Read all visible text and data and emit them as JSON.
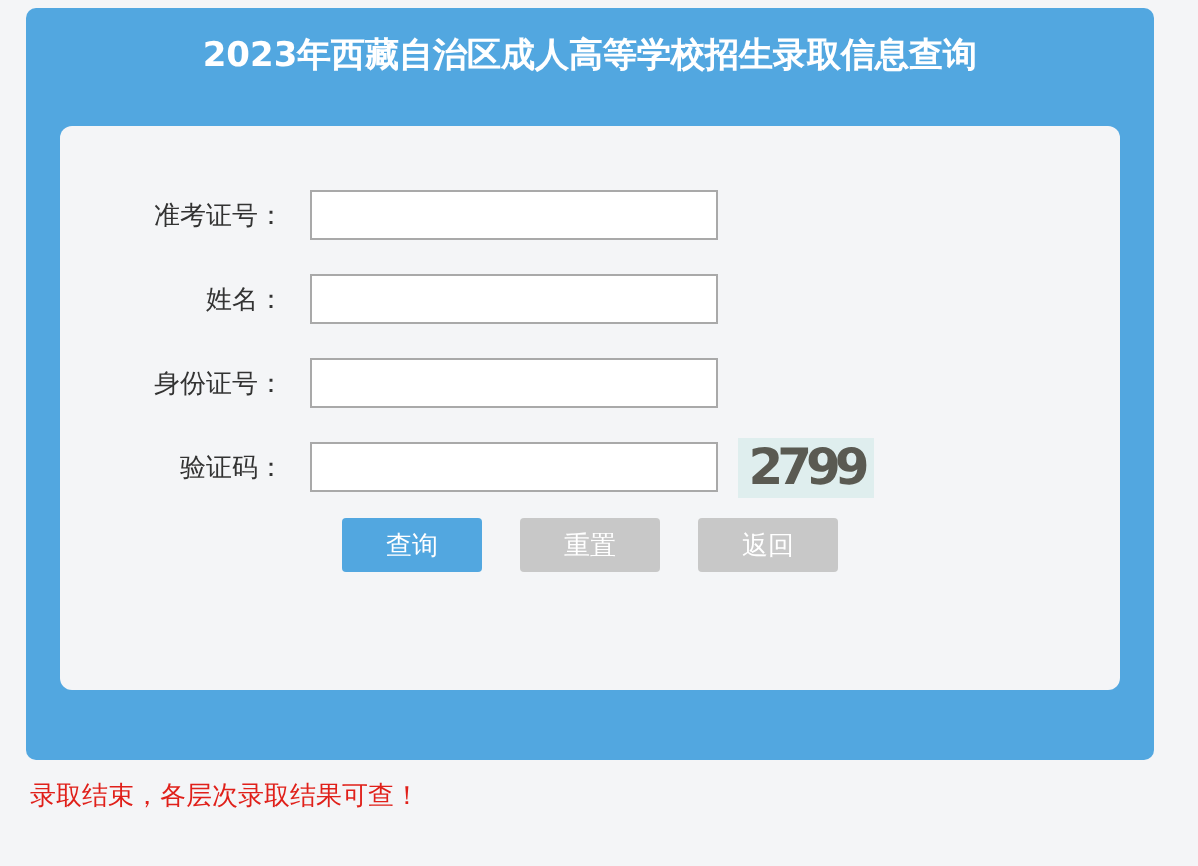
{
  "title": "2023年西藏自治区成人高等学校招生录取信息查询",
  "fields": [
    {
      "label": "准考证号："
    },
    {
      "label": "姓名："
    },
    {
      "label": "身份证号："
    },
    {
      "label": "验证码：",
      "kind": "captcha"
    }
  ],
  "captcha": "2799",
  "buttons": [
    {
      "label": "查询",
      "kind": "primary"
    },
    {
      "label": "重置",
      "kind": "secondary"
    },
    {
      "label": "返回",
      "kind": "secondary"
    }
  ],
  "notice": "录取结束，各层次录取结果可查！"
}
